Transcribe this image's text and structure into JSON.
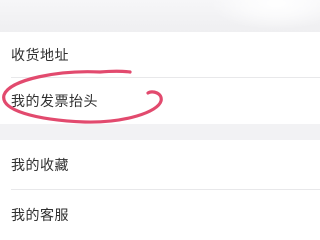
{
  "account_menu": {
    "items": [
      {
        "label": "收货地址"
      },
      {
        "label": "我的发票抬头"
      },
      {
        "label": "我的收藏"
      },
      {
        "label": "我的客服"
      }
    ]
  },
  "annotation": {
    "type": "hand-drawn-circle",
    "color": "#e24a6e",
    "target": "我的发票抬头"
  }
}
